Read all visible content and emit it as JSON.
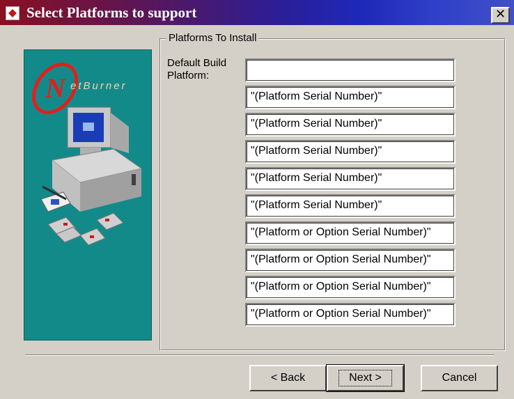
{
  "window": {
    "title": "Select Platforms to support",
    "close_glyph": "✕"
  },
  "side_panel": {
    "logo_text": "etBurner",
    "logo_letter": "N"
  },
  "group": {
    "legend": "Platforms To Install",
    "label": "Default Build Platform:",
    "fields": [
      "",
      "\"(Platform Serial Number)\"",
      "\"(Platform Serial Number)\"",
      "\"(Platform Serial Number)\"",
      "\"(Platform Serial Number)\"",
      "\"(Platform Serial Number)\"",
      "\"(Platform or Option Serial Number)\"",
      "\"(Platform or Option Serial Number)\"",
      "\"(Platform or Option Serial Number)\"",
      "\"(Platform or Option Serial Number)\""
    ]
  },
  "buttons": {
    "back": "< Back",
    "next": "Next >",
    "cancel": "Cancel"
  },
  "colors": {
    "panel": "#138a8a",
    "dialog": "#d4d0c8",
    "title_start": "#8a1020",
    "title_end": "#3040c8"
  }
}
